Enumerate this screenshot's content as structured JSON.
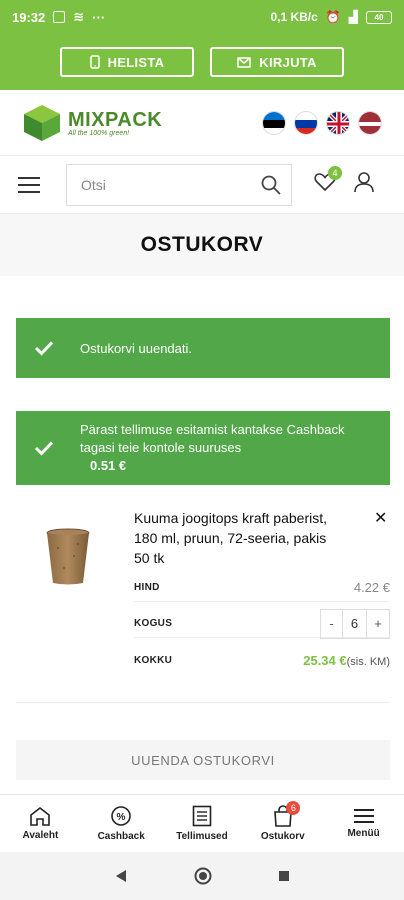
{
  "status_bar": {
    "time": "19:32",
    "speed": "0,1 KB/c",
    "battery": "40"
  },
  "contact": {
    "call_label": "HELISTA",
    "write_label": "KIRJUTA"
  },
  "logo": {
    "name": "MIXPACK",
    "tagline": "All the 100% green!"
  },
  "languages": [
    "et",
    "ru",
    "en",
    "lv"
  ],
  "search": {
    "placeholder": "Otsi"
  },
  "wishlist_count": "4",
  "page_title": "OSTUKORV",
  "notices": {
    "updated": "Ostukorvi uuendati.",
    "cashback_text": "Pärast tellimuse esitamist kantakse Cashback tagasi teie kontole suuruses",
    "cashback_amount": "0.51 €"
  },
  "cart_item": {
    "name": "Kuuma joogitops kraft paberist, 180 ml, pruun, 72-seeria, pakis 50 tk",
    "price_label": "HIND",
    "price": "4.22 €",
    "qty_label": "KOGUS",
    "qty_minus": "-",
    "qty": "6",
    "qty_plus": "+",
    "total_label": "KOKKU",
    "total": "25.34 €",
    "total_vat": "(sis. KM)",
    "remove": "✕"
  },
  "update_button": "UUENDA OSTUKORVI",
  "bottom_nav": {
    "home": "Avaleht",
    "cashback": "Cashback",
    "orders": "Tellimused",
    "cart": "Ostukorv",
    "cart_count": "6",
    "menu": "Menüü"
  },
  "colors": {
    "brand_green": "#7cc142",
    "notice_green": "#52a849",
    "badge_red": "#e74c3c"
  }
}
